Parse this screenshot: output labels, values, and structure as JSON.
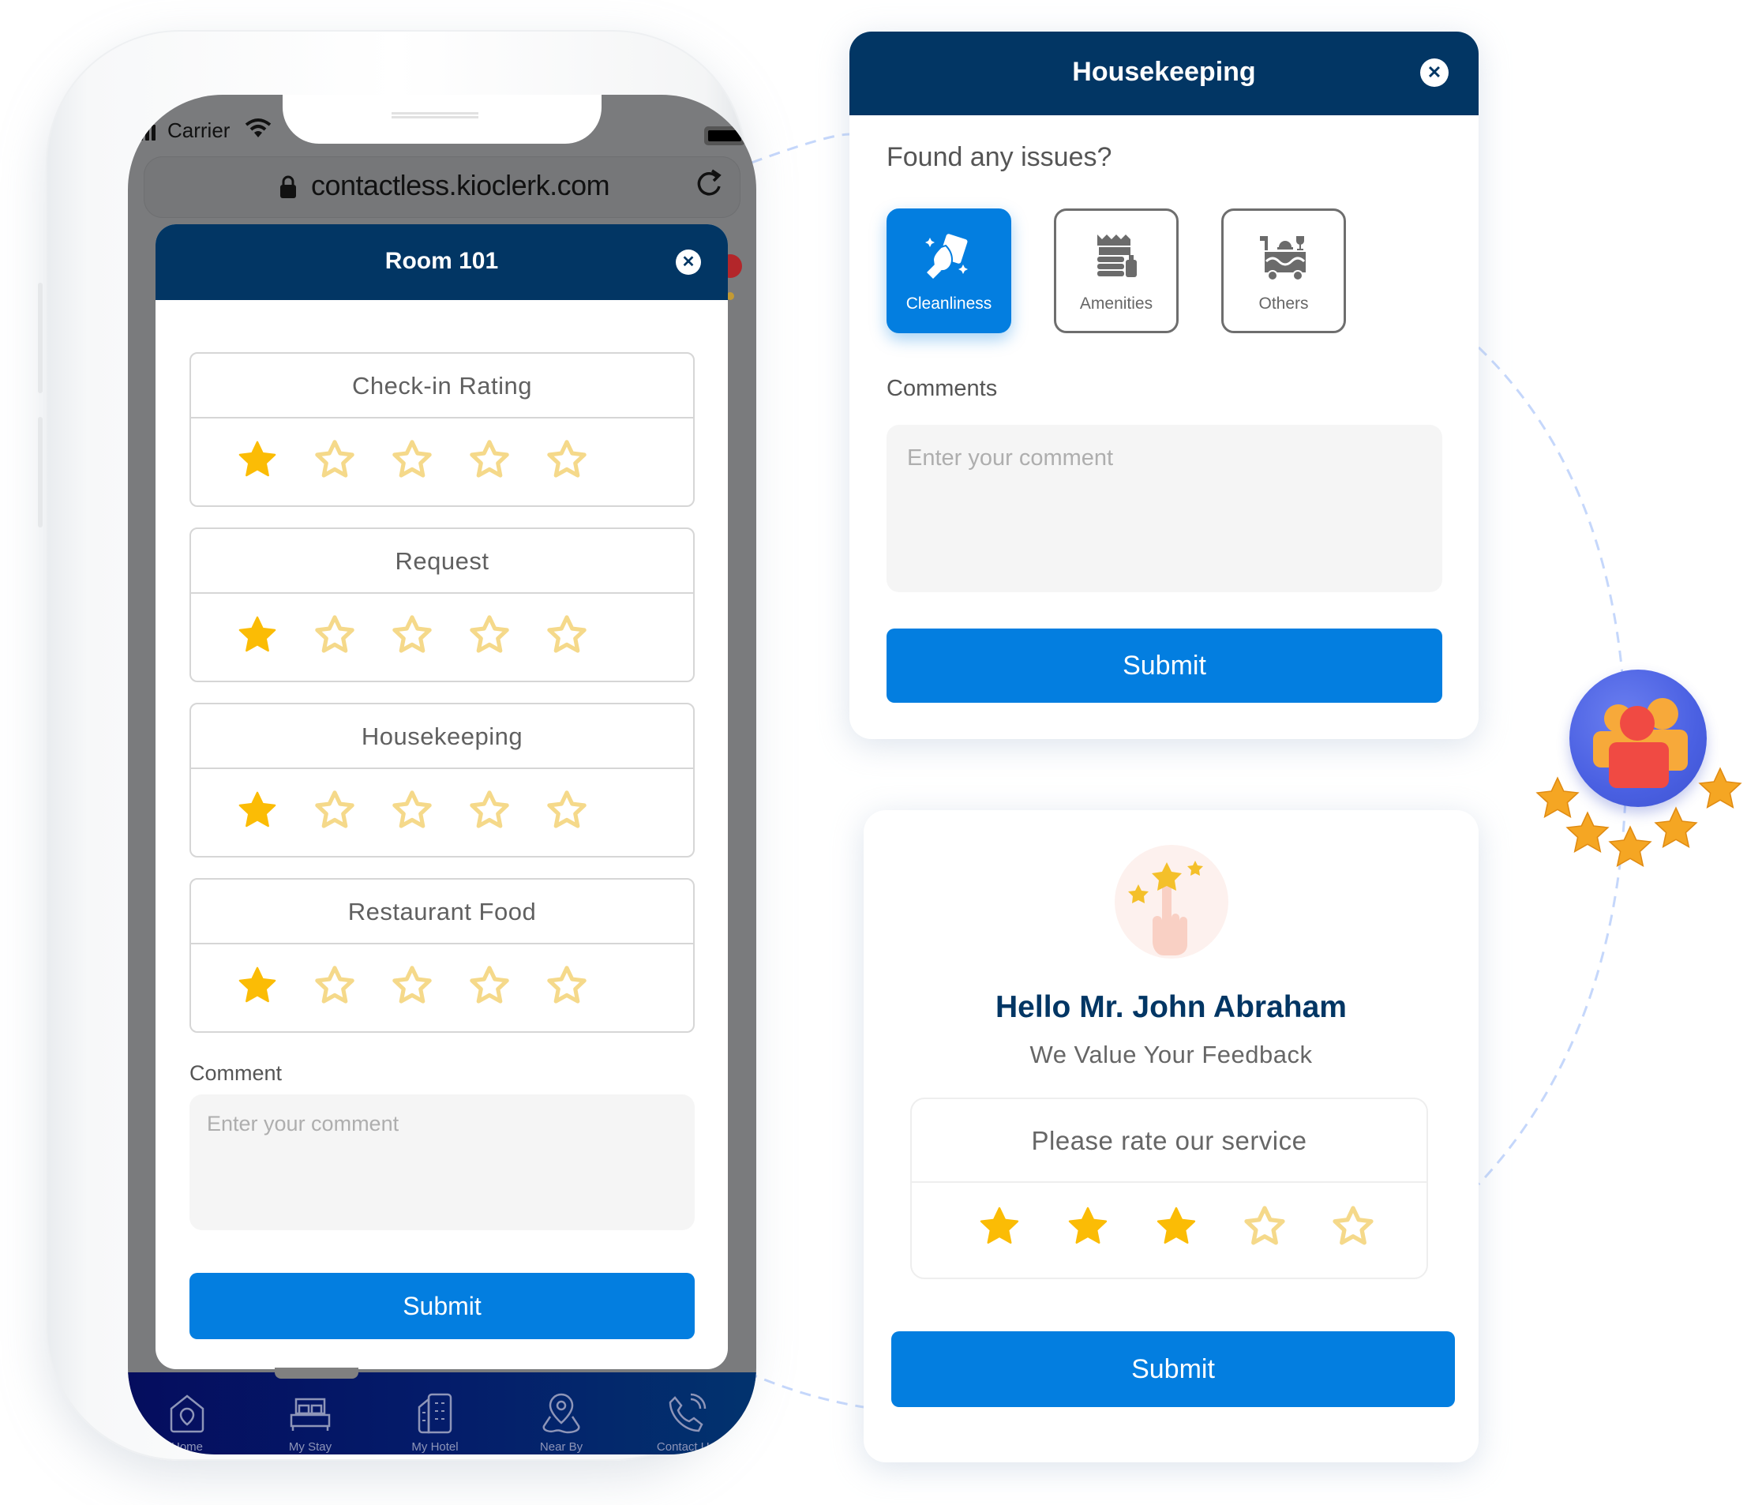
{
  "phone": {
    "status_bar": {
      "carrier": "Carrier",
      "signal_icon": "signal-bars-icon",
      "wifi_icon": "wifi-icon",
      "battery_icon": "battery-icon"
    },
    "browser": {
      "url": "contactless.kioclerk.com",
      "lock_icon": "lock-icon",
      "reload_icon": "reload-icon"
    },
    "modal": {
      "title": "Room 101",
      "close_icon": "close-icon",
      "ratings": [
        {
          "label": "Check-in Rating",
          "value": 1,
          "max": 5
        },
        {
          "label": "Request",
          "value": 1,
          "max": 5
        },
        {
          "label": "Housekeeping",
          "value": 1,
          "max": 5
        },
        {
          "label": "Restaurant Food",
          "value": 1,
          "max": 5
        }
      ],
      "comment_label": "Comment",
      "comment_placeholder": "Enter your comment",
      "comment_value": "",
      "submit_label": "Submit"
    },
    "bottom_nav": [
      {
        "label": "Home",
        "icon": "home-icon"
      },
      {
        "label": "My Stay",
        "icon": "bed-icon"
      },
      {
        "label": "My Hotel",
        "icon": "buildings-icon"
      },
      {
        "label": "Near By",
        "icon": "map-pin-icon"
      },
      {
        "label": "Contact Us",
        "icon": "phone-icon"
      }
    ]
  },
  "housekeeping": {
    "title": "Housekeeping",
    "close_icon": "close-icon",
    "question": "Found any issues?",
    "issues": [
      {
        "label": "Cleanliness",
        "icon": "cleaning-hand-icon",
        "selected": true
      },
      {
        "label": "Amenities",
        "icon": "amenities-icon",
        "selected": false
      },
      {
        "label": "Others",
        "icon": "service-cart-icon",
        "selected": false
      }
    ],
    "comments_label": "Comments",
    "comment_placeholder": "Enter your comment",
    "comment_value": "",
    "submit_label": "Submit"
  },
  "feedback": {
    "illustration_icon": "rate-stars-hand-icon",
    "greeting": "Hello Mr. John Abraham",
    "subtitle": "We Value Your Feedback",
    "rate_label": "Please rate our service",
    "rating": {
      "value": 3,
      "max": 5
    },
    "submit_label": "Submit"
  },
  "decoration": {
    "badge_icon": "group-users-icon",
    "badge_stars": 5
  },
  "colors": {
    "header_navy": "#023664",
    "primary_blue": "#037ee0",
    "star_filled": "#fbbc05",
    "star_empty": "#f5d98a",
    "badge_blue": "#4a60e2"
  }
}
